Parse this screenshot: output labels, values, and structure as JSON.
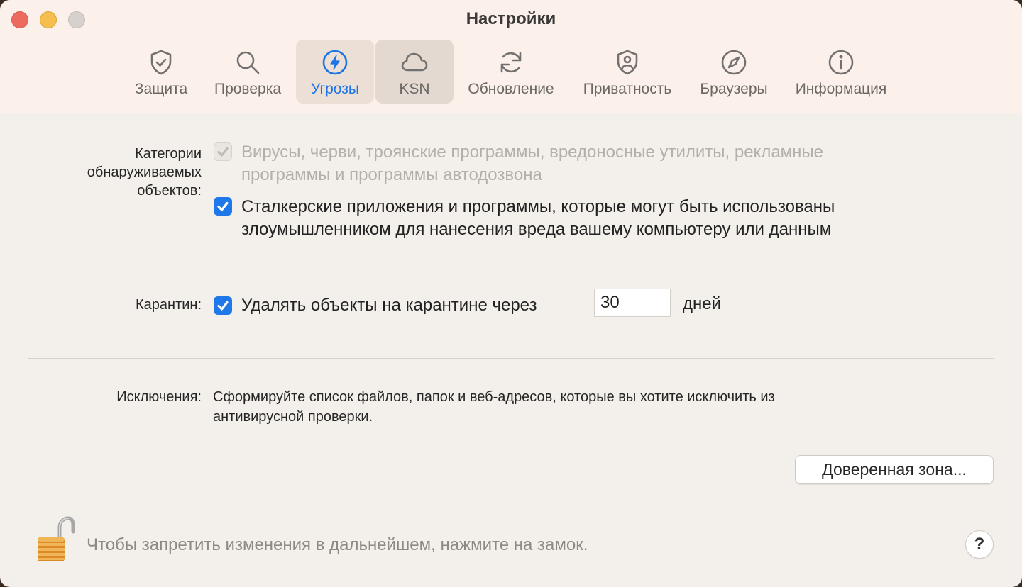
{
  "window": {
    "title": "Настройки"
  },
  "toolbar": {
    "tabs": [
      {
        "label": "Защита",
        "icon": "shield-check-icon"
      },
      {
        "label": "Проверка",
        "icon": "magnifier-icon"
      },
      {
        "label": "Угрозы",
        "icon": "bolt-circle-icon",
        "selected": true
      },
      {
        "label": "KSN",
        "icon": "cloud-icon"
      },
      {
        "label": "Обновление",
        "icon": "refresh-icon"
      },
      {
        "label": "Приватность",
        "icon": "privacy-shield-icon"
      },
      {
        "label": "Браузеры",
        "icon": "compass-icon"
      },
      {
        "label": "Информация",
        "icon": "info-icon"
      }
    ]
  },
  "threats": {
    "categories_label": "Категории обнаруживаемых объектов:",
    "categories_label_lines": [
      "Категории",
      "обнаруживаемых",
      "объектов:"
    ],
    "option_viruses": {
      "lines": [
        "Вирусы, черви, троянские программы, вредоносные утилиты, рекламные",
        "программы и программы автодозвона"
      ],
      "checked": true,
      "disabled": true
    },
    "option_stalkerware": {
      "lines": [
        "Сталкерские приложения и программы, которые могут быть использованы",
        "злоумышленником для нанесения вреда вашему компьютеру или данным"
      ],
      "checked": true
    }
  },
  "quarantine": {
    "label": "Карантин:",
    "option_text": "Удалять объекты на карантине через",
    "checked": true,
    "days_value": "30",
    "days_unit": "дней"
  },
  "exclusions": {
    "label": "Исключения:",
    "description_lines": [
      "Сформируйте список файлов, папок и веб-адресов, которые вы хотите исключить из",
      "антивирусной проверки."
    ],
    "trusted_zone_button": "Доверенная зона..."
  },
  "footer": {
    "lock_hint": "Чтобы запретить изменения в дальнейшем, нажмите на замок.",
    "help_label": "?"
  },
  "colors": {
    "accent": "#1f78ea",
    "window_bg": "#f3efeb",
    "toolbar_bg": "#fbf1ea"
  }
}
